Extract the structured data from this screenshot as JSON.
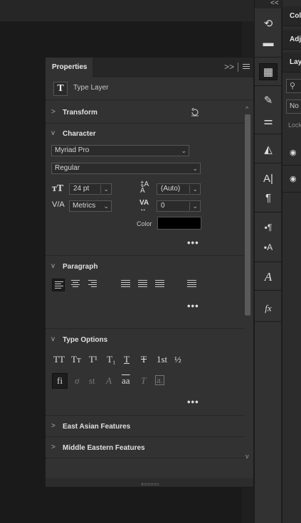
{
  "properties_panel": {
    "tab_label": "Properties",
    "collapse_glyph": ">>",
    "layer_kind_glyph": "T",
    "layer_kind_label": "Type Layer",
    "scroll_up_glyph": "^",
    "scroll_down_glyph": "v"
  },
  "sections": {
    "transform": {
      "title": "Transform",
      "chevron": ">",
      "reset_icon": "reset-icon"
    },
    "character": {
      "title": "Character",
      "chevron": "v",
      "font_family": "Myriad Pro",
      "font_style": "Regular",
      "font_size": "24 pt",
      "leading": "(Auto)",
      "kerning": "Metrics",
      "tracking": "0",
      "color_label": "Color",
      "color_value": "#000000",
      "more": "•••"
    },
    "paragraph": {
      "title": "Paragraph",
      "chevron": "v",
      "more": "•••"
    },
    "type_options": {
      "title": "Type Options",
      "chevron": "v",
      "row1": [
        "TT",
        "Tт",
        "T¹",
        "T₁",
        "T",
        "T",
        "1st",
        "½"
      ],
      "row2": [
        "fi",
        "σ",
        "st",
        "A",
        "aa",
        "T",
        "a."
      ],
      "more": "•••"
    },
    "east_asian": {
      "title": "East Asian Features",
      "chevron": ">"
    },
    "middle_eastern": {
      "title": "Middle Eastern Features",
      "chevron": ">"
    }
  },
  "right_panels": {
    "collapse_glyph": "<<",
    "tabs": [
      "Colo",
      "Adj",
      "Lay"
    ],
    "blend_mode": "No",
    "lock_label": "Lock",
    "search_glyph": "⚲"
  },
  "tools": [
    "history-icon",
    "comment-icon",
    "libraries-icon",
    "brush-icon",
    "adjust-icon",
    "shape-icon",
    "character-icon",
    "paragraph-icon",
    "paragraph-styles-icon",
    "character-styles-icon",
    "glyphs-icon",
    "fx-icon"
  ]
}
